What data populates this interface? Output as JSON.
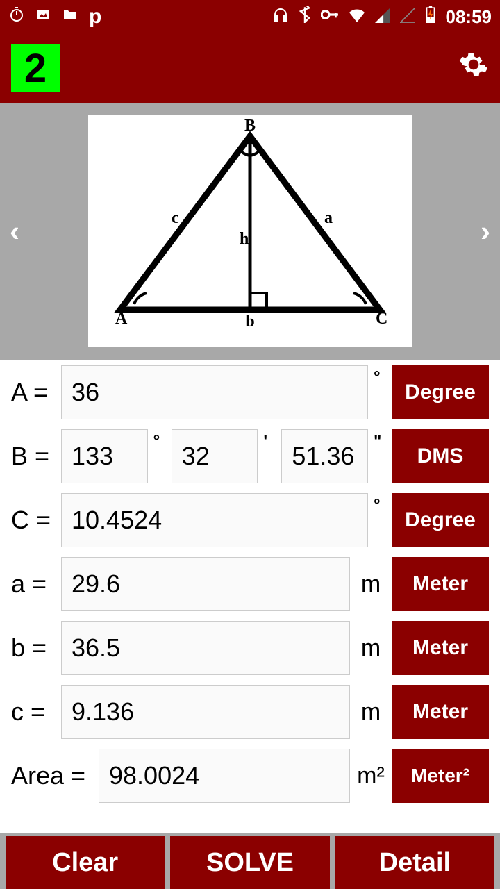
{
  "status": {
    "time": "08:59"
  },
  "header": {
    "badge": "2"
  },
  "diagram": {
    "vertices": {
      "A": "A",
      "B": "B",
      "C": "C"
    },
    "sides": {
      "a": "a",
      "b": "b",
      "c": "c",
      "h": "h"
    }
  },
  "rows": {
    "A": {
      "label": "A =",
      "value": "36",
      "unit_btn": "Degree"
    },
    "B": {
      "label": "B =",
      "d": "133",
      "m": "32",
      "s": "51.36",
      "unit_btn": "DMS"
    },
    "C": {
      "label": "C =",
      "value": "10.4524",
      "unit_btn": "Degree"
    },
    "a": {
      "label": "a =",
      "value": "29.6",
      "unit": "m",
      "unit_btn": "Meter"
    },
    "b": {
      "label": "b =",
      "value": "36.5",
      "unit": "m",
      "unit_btn": "Meter"
    },
    "c": {
      "label": "c =",
      "value": "9.136",
      "unit": "m",
      "unit_btn": "Meter"
    },
    "Area": {
      "label": "Area =",
      "value": "98.0024",
      "unit": "m²",
      "unit_btn": "Meter²"
    }
  },
  "buttons": {
    "clear": "Clear",
    "solve": "SOLVE",
    "detail": "Detail"
  },
  "symbols": {
    "deg": "°",
    "min": "'",
    "sec": "\""
  }
}
